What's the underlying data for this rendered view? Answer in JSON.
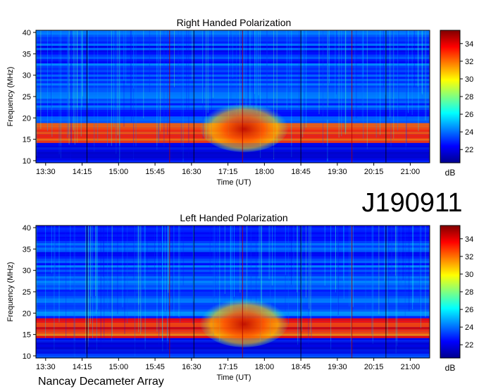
{
  "stamp": "J190911",
  "footer": "Nancay Decameter Array",
  "colorbar": {
    "unit": "dB",
    "ticks": [
      "22",
      "24",
      "26",
      "28",
      "30",
      "32",
      "34"
    ],
    "range": [
      20.5,
      35.5
    ],
    "colormap": [
      "#00008f",
      "#0000ff",
      "#0080ff",
      "#00ffff",
      "#80ff80",
      "#ffff00",
      "#ff8000",
      "#ff0000",
      "#800000"
    ]
  },
  "chart_data": [
    {
      "type": "heatmap",
      "title": "Right Handed Polarization",
      "xlabel": "Time (UT)",
      "ylabel": "Frequency (MHz)",
      "x_ticks": [
        "13:30",
        "14:15",
        "15:00",
        "15:45",
        "16:30",
        "17:15",
        "18:00",
        "18:45",
        "19:30",
        "20:15",
        "21:00"
      ],
      "y_ticks": [
        "10",
        "15",
        "20",
        "25",
        "30",
        "35",
        "40"
      ],
      "x_range_hours": [
        13.3,
        21.4
      ],
      "y_range_mhz": [
        9.5,
        40.5
      ],
      "intensity_db": [
        {
          "band_mhz": [
            10,
            14
          ],
          "level_db": 22
        },
        {
          "band_mhz": [
            14,
            19
          ],
          "level_db": 33
        },
        {
          "band_mhz": [
            19,
            40
          ],
          "level_db": 24
        }
      ],
      "burst": {
        "t_start": "16:40",
        "t_end": "18:30",
        "f_low_mhz": 14,
        "f_high_mhz": 24,
        "level_db": 34
      }
    },
    {
      "type": "heatmap",
      "title": "Left Handed Polarization",
      "xlabel": "Time (UT)",
      "ylabel": "Frequency (MHz)",
      "x_ticks": [
        "13:30",
        "14:15",
        "15:00",
        "15:45",
        "16:30",
        "17:15",
        "18:00",
        "18:45",
        "19:30",
        "20:15",
        "21:00"
      ],
      "y_ticks": [
        "10",
        "15",
        "20",
        "25",
        "30",
        "35",
        "40"
      ],
      "x_range_hours": [
        13.3,
        21.4
      ],
      "y_range_mhz": [
        9.5,
        40.5
      ],
      "intensity_db": [
        {
          "band_mhz": [
            10,
            14
          ],
          "level_db": 22
        },
        {
          "band_mhz": [
            14,
            19
          ],
          "level_db": 33
        },
        {
          "band_mhz": [
            19,
            40
          ],
          "level_db": 24
        }
      ],
      "burst": {
        "t_start": "16:40",
        "t_end": "18:30",
        "f_low_mhz": 14,
        "f_high_mhz": 24,
        "level_db": 34
      }
    }
  ]
}
